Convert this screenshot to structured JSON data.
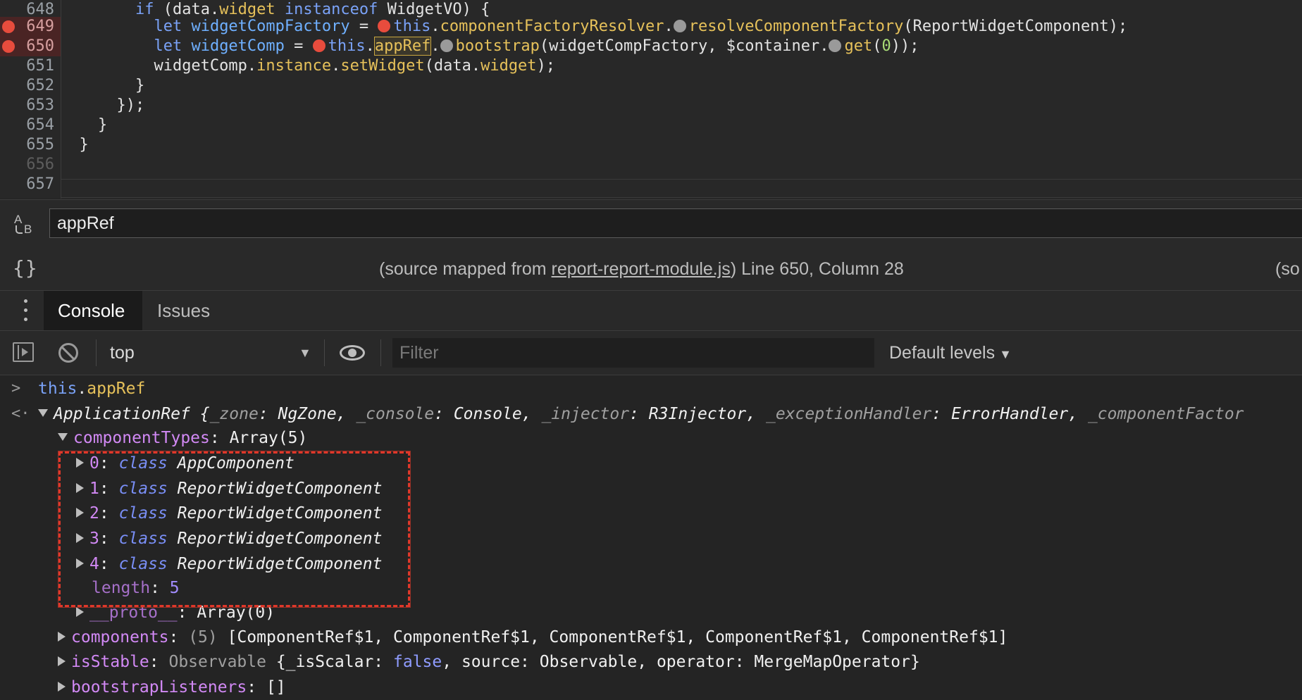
{
  "editor": {
    "lines": [
      {
        "n": "648",
        "breakpoint": false
      },
      {
        "n": "649",
        "breakpoint": true
      },
      {
        "n": "650",
        "breakpoint": true
      },
      {
        "n": "651",
        "breakpoint": false
      },
      {
        "n": "652",
        "breakpoint": false
      },
      {
        "n": "653",
        "breakpoint": false
      },
      {
        "n": "654",
        "breakpoint": false
      },
      {
        "n": "655",
        "breakpoint": false
      },
      {
        "n": "656",
        "breakpoint": false
      },
      {
        "n": "657",
        "breakpoint": false
      }
    ],
    "code": {
      "l648": {
        "indent": "        ",
        "kw_if": "if",
        "p1": " (data.",
        "widget": "widget",
        "sp": " ",
        "kw_instanceof": "instanceof",
        "p2": " WidgetVO) {"
      },
      "l649": {
        "indent": "          ",
        "kw_let": "let",
        "sp": " ",
        "var": "widgetCompFactory",
        "eq": " = ",
        "kw_this": "this",
        "dot": ".",
        "prop": "componentFactoryResolver",
        "dot2": ".",
        "fn": "resolveComponentFactory",
        "rest": "(ReportWidgetComponent);"
      },
      "l650": {
        "indent": "          ",
        "kw_let": "let",
        "sp": " ",
        "var": "widgetComp",
        "eq": " = ",
        "kw_this": "this",
        "dot": ".",
        "prop": "appRef",
        "dot2": ".",
        "fn": "bootstrap",
        "mid": "(widgetCompFactory, $container.",
        "fn2": "get",
        "open": "(",
        "num": "0",
        "close": "));"
      },
      "l651": {
        "indent": "          ",
        "p1": "widgetComp.",
        "prop": "instance",
        "dot": ".",
        "fn": "setWidget",
        "rest": "(data.",
        "prop2": "widget",
        "end": ");"
      },
      "l652": {
        "text": "        }"
      },
      "l653": {
        "text": "      });"
      },
      "l654": {
        "text": "    }"
      },
      "l655": {
        "text": "  }"
      }
    }
  },
  "search": {
    "icon": "match-case-icon",
    "value": "appRef"
  },
  "status": {
    "icon": "pretty-print-icon",
    "icon_text": "{}",
    "prefix": "(source mapped from ",
    "link": "report-report-module.js",
    "suffix": ") Line 650, Column 28",
    "right": "(so"
  },
  "drawer": {
    "menu_icon": "kebab-menu-icon",
    "tabs": [
      {
        "label": "Console",
        "active": true
      },
      {
        "label": "Issues",
        "active": false
      }
    ]
  },
  "toolbar": {
    "sidebar_icon": "show-sidebar-icon",
    "clear_icon": "clear-console-icon",
    "context": "top",
    "eye_icon": "live-expression-eye-icon",
    "filter_placeholder": "Filter",
    "levels": "Default levels"
  },
  "console": {
    "input": {
      "this": "this",
      "dot": ".",
      "prop": "appRef"
    },
    "result": {
      "name": "ApplicationRef",
      "open": " {",
      "k1": "_zone",
      "v1": "NgZone",
      "k2": "_console",
      "v2": "Console",
      "k3": "_injector",
      "v3": "R3Injector",
      "k4": "_exceptionHandler",
      "v4": "ErrorHandler",
      "k5": "_componentFactor",
      "colon": ": ",
      "comma": ", "
    },
    "component_types": {
      "key": "componentTypes",
      "value": "Array(5)"
    },
    "items": [
      {
        "idx": "0",
        "kw": "class",
        "name": "AppComponent"
      },
      {
        "idx": "1",
        "kw": "class",
        "name": "ReportWidgetComponent"
      },
      {
        "idx": "2",
        "kw": "class",
        "name": "ReportWidgetComponent"
      },
      {
        "idx": "3",
        "kw": "class",
        "name": "ReportWidgetComponent"
      },
      {
        "idx": "4",
        "kw": "class",
        "name": "ReportWidgetComponent"
      }
    ],
    "length": {
      "key": "length",
      "value": "5"
    },
    "proto": {
      "key": "__proto__",
      "value": "Array(0)"
    },
    "components": {
      "key": "components",
      "count": "(5)",
      "value": "[ComponentRef$1, ComponentRef$1, ComponentRef$1, ComponentRef$1, ComponentRef$1]"
    },
    "is_stable": {
      "key": "isStable",
      "type": "Observable",
      "open": " {",
      "k1": "_isScalar",
      "v1": "false",
      "k2": "source",
      "v2": "Observable",
      "k3": "operator",
      "v3": "MergeMapOperator",
      "close": "}"
    },
    "bootstrap_listeners": {
      "key": "bootstrapListeners",
      "value": "[]"
    }
  },
  "colors": {
    "breakpoint": "#e84c3d",
    "annotation": "#e0382a",
    "background": "#242424"
  }
}
